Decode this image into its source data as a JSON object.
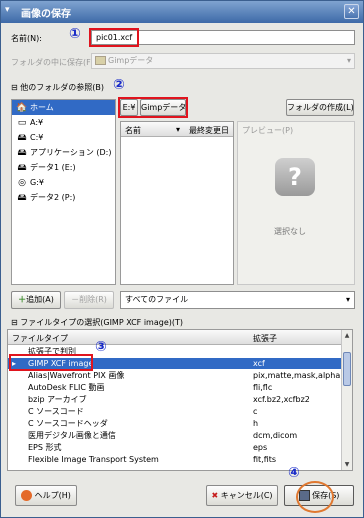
{
  "window": {
    "title": "画像の保存",
    "sysmenu_glyph": "▾",
    "close_glyph": "✕"
  },
  "name_row": {
    "label": "名前(N):",
    "value": "pic01.xcf"
  },
  "save_in": {
    "label": "フォルダの中に保存(F):",
    "value": "Gimpデータ",
    "arrow": "▾"
  },
  "browse": {
    "expander": "⊟",
    "label": "他のフォルダの参照(B)"
  },
  "path_buttons": [
    "E:¥",
    "Gimpデータ"
  ],
  "create_folder_label": "フォルダの作成(L)",
  "places": [
    {
      "icon": "🏠",
      "label": "ホーム",
      "icon_name": "home-icon"
    },
    {
      "icon": "▭",
      "label": "A:¥",
      "icon_name": "floppy-drive-icon"
    },
    {
      "icon": "🖴",
      "label": "C:¥",
      "icon_name": "hard-drive-icon"
    },
    {
      "icon": "🖴",
      "label": "アプリケーション (D:)",
      "icon_name": "hard-drive-icon"
    },
    {
      "icon": "🖴",
      "label": "データ1 (E:)",
      "icon_name": "hard-drive-icon"
    },
    {
      "icon": "◎",
      "label": "G:¥",
      "icon_name": "cdrom-drive-icon"
    },
    {
      "icon": "🖴",
      "label": "データ2 (P:)",
      "icon_name": "hard-drive-icon"
    }
  ],
  "files_header": {
    "name": "名前",
    "sort_arrow": "▾",
    "modified": "最終変更日"
  },
  "preview": {
    "header": "プレビュー(P)",
    "icon_glyph": "?",
    "none_text": "選択なし"
  },
  "add_button": "追加(A)",
  "remove_button": "削除(R)",
  "filter": {
    "value": "すべてのファイル",
    "arrow": "▾"
  },
  "filetype": {
    "expander": "⊟",
    "label": "ファイルタイプの選択(GIMP XCF image)(T)"
  },
  "ftable": {
    "col_type": "ファイルタイプ",
    "col_ext": "拡張子",
    "rows": [
      {
        "type": "拡張子で判別",
        "ext": ""
      },
      {
        "type": "GIMP XCF image",
        "ext": "xcf"
      },
      {
        "type": "Alias|Wavefront PIX 画像",
        "ext": "pix,matte,mask,alpha,als"
      },
      {
        "type": "AutoDesk FLIC 動画",
        "ext": "fli,flc"
      },
      {
        "type": "bzip アーカイブ",
        "ext": "xcf.bz2,xcfbz2"
      },
      {
        "type": "C ソースコード",
        "ext": "c"
      },
      {
        "type": "C ソースコードヘッダ",
        "ext": "h"
      },
      {
        "type": "医用デジタル画像と通信",
        "ext": "dcm,dicom"
      },
      {
        "type": "EPS 形式",
        "ext": "eps"
      },
      {
        "type": "Flexible Image Transport System",
        "ext": "fit,fits"
      }
    ],
    "selected_index": 1,
    "selected_arrow": "▸"
  },
  "help_button": "ヘルプ(H)",
  "cancel_button": "キャンセル(C)",
  "save_button": "保存(S)",
  "annotations": [
    "①",
    "②",
    "③",
    "④"
  ],
  "colors": {
    "selection": "#316ac5",
    "annotation_box": "#e0141e",
    "annotation_number": "#1a2cc8",
    "annotation_circle": "#e07830"
  }
}
